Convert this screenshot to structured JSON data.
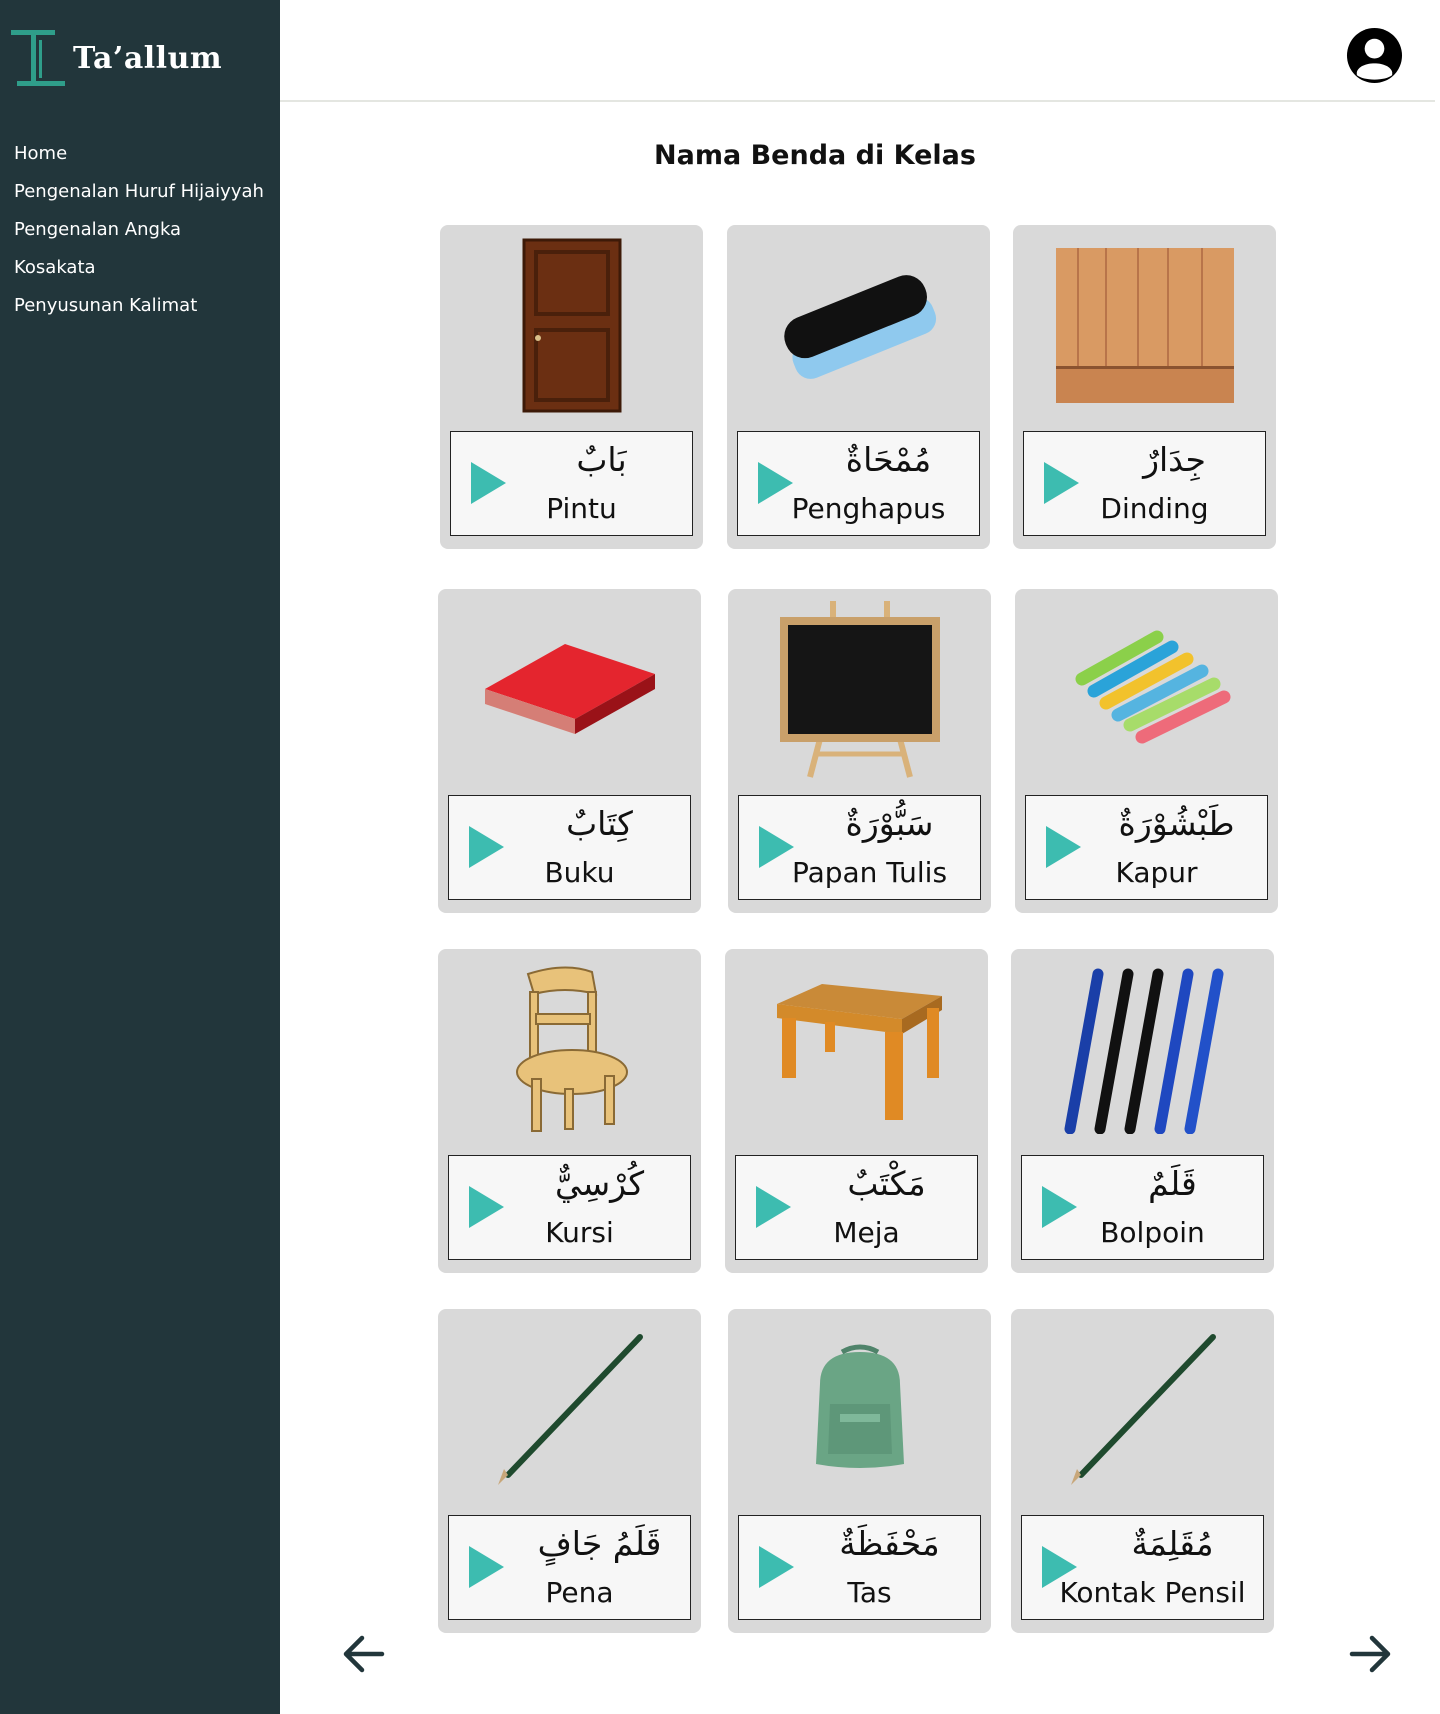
{
  "app": {
    "name": "Ta’allum"
  },
  "sidebar": {
    "items": [
      {
        "label": "Home"
      },
      {
        "label": "Pengenalan Huruf Hijaiyyah"
      },
      {
        "label": "Pengenalan Angka"
      },
      {
        "label": "Kosakata"
      },
      {
        "label": "Penyusunan Kalimat"
      }
    ]
  },
  "header": {
    "avatar_icon": "user-circle-icon"
  },
  "main": {
    "title": "Nama Benda di Kelas",
    "cards": [
      {
        "arabic": "بَابٌ",
        "latin": "Pintu",
        "image": "door"
      },
      {
        "arabic": "مُمْحَاةٌ",
        "latin": "Penghapus",
        "image": "eraser"
      },
      {
        "arabic": "جِدَارٌ",
        "latin": "Dinding",
        "image": "wall"
      },
      {
        "arabic": "كِتَابٌ",
        "latin": "Buku",
        "image": "book"
      },
      {
        "arabic": "سَبُّوْرَةٌ",
        "latin": "Papan Tulis",
        "image": "blackboard"
      },
      {
        "arabic": "طَبْشُوْرَةٌ",
        "latin": "Kapur",
        "image": "chalk"
      },
      {
        "arabic": "كُرْسِيٌّ",
        "latin": "Kursi",
        "image": "chair"
      },
      {
        "arabic": "مَكْتَبٌ",
        "latin": "Meja",
        "image": "table"
      },
      {
        "arabic": "قَلَمٌ",
        "latin": "Bolpoin",
        "image": "pens"
      },
      {
        "arabic": "قَلَمُ جَافٍ",
        "latin": "Pena",
        "image": "pencil"
      },
      {
        "arabic": "مَحْفَظَةٌ",
        "latin": "Tas",
        "image": "backpack"
      },
      {
        "arabic": "مُقَلِمَةٌ",
        "latin": "Kontak Pensil",
        "image": "pencil"
      }
    ]
  },
  "navigation": {
    "prev_icon": "arrow-left-icon",
    "next_icon": "arrow-right-icon"
  },
  "colors": {
    "sidebar": "#22363b",
    "accent": "#3dbcb0",
    "card": "#d9d9d9"
  }
}
